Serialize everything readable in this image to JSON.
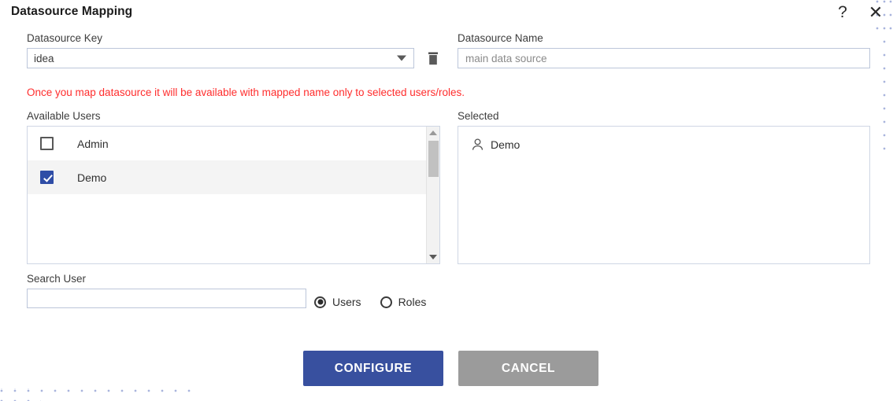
{
  "window": {
    "title": "Datasource Mapping",
    "help_icon": "?",
    "close_icon": "✕"
  },
  "form": {
    "key_label": "Datasource Key",
    "key_value": "idea",
    "key_dropdown_icon": "chevron-down-icon",
    "delete_icon": "trash-icon",
    "name_label": "Datasource Name",
    "name_value": "",
    "name_placeholder": "main data source",
    "warning": "Once you map datasource it will be available with mapped name only to selected users/roles.",
    "warning_color": "#ff2d2d"
  },
  "available": {
    "label": "Available Users",
    "rows": [
      {
        "name": "Admin",
        "checked": false
      },
      {
        "name": "Demo",
        "checked": true
      }
    ],
    "scrollbar": {
      "up_arrow": "triangle-up-icon",
      "down_arrow": "triangle-down-icon"
    }
  },
  "selected": {
    "label": "Selected",
    "rows": [
      {
        "name": "Demo",
        "icon": "person-icon"
      }
    ]
  },
  "search": {
    "label": "Search User",
    "value": "",
    "placeholder": "",
    "options": [
      {
        "label": "Users",
        "selected": true
      },
      {
        "label": "Roles",
        "selected": false
      }
    ]
  },
  "actions": {
    "configure_label": "CONFIGURE",
    "cancel_label": "CANCEL",
    "configure_color": "#38509f",
    "cancel_color": "#9b9b9b"
  }
}
